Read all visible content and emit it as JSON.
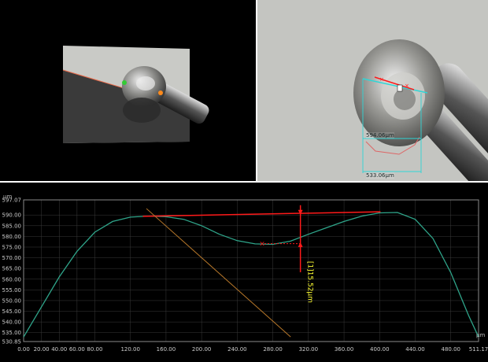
{
  "windows": {
    "left_view": {
      "name": "3d-view"
    },
    "right_view": {
      "name": "zoom-view",
      "measurement_1": "594.06µm",
      "measurement_2": "533.06µm"
    }
  },
  "profile": {
    "unit_label": "µm",
    "annotation_label": "[1]15.52µm",
    "colors": {
      "curve": "#2fa58a",
      "measure": "#ff1a1a",
      "guide": "#b8782a",
      "annotation": "#ffff33"
    },
    "chart_data": {
      "type": "line",
      "title": "",
      "xlabel": "",
      "ylabel": "µm",
      "xlim": [
        0,
        511.17
      ],
      "ylim": [
        530.85,
        597.07
      ],
      "x_ticks": [
        "0.00",
        "20.00",
        "40.00",
        "60.00",
        "80.00",
        "120.00",
        "160.00",
        "200.00",
        "240.00",
        "280.00",
        "320.00",
        "360.00",
        "400.00",
        "440.00",
        "480.00",
        "511.17"
      ],
      "y_ticks": [
        "597.07",
        "590.00",
        "585.00",
        "580.00",
        "575.00",
        "570.00",
        "565.00",
        "560.00",
        "555.00",
        "550.00",
        "545.00",
        "540.00",
        "535.00",
        "530.85"
      ],
      "series": [
        {
          "x": [
            0,
            20,
            40,
            60,
            80,
            100,
            120,
            140,
            160,
            180,
            200,
            220,
            240,
            260,
            280,
            300,
            320,
            340,
            360,
            380,
            400,
            420,
            440,
            460,
            480,
            500,
            511.17
          ],
          "y": [
            533,
            547,
            561,
            573,
            582,
            587,
            589,
            589.5,
            589.2,
            588,
            585,
            581,
            578,
            576.5,
            576.3,
            577.8,
            581,
            584,
            587,
            589.5,
            591,
            591.2,
            588,
            579,
            563,
            543,
            533
          ]
        }
      ],
      "annotations": [
        {
          "type": "line",
          "from": [
            134,
            589.4
          ],
          "to": [
            401,
            591.5
          ],
          "label": ""
        },
        {
          "type": "vertical-measure",
          "x": 311,
          "y_top": 590.9,
          "y_bottom": 576.5,
          "label": "[1]15.52µm"
        },
        {
          "type": "marker",
          "x": 268,
          "y": 576.6
        },
        {
          "type": "guide-line",
          "from": [
            138,
            593
          ],
          "to": [
            300,
            533
          ]
        }
      ],
      "grid": true,
      "legend": "none"
    }
  }
}
